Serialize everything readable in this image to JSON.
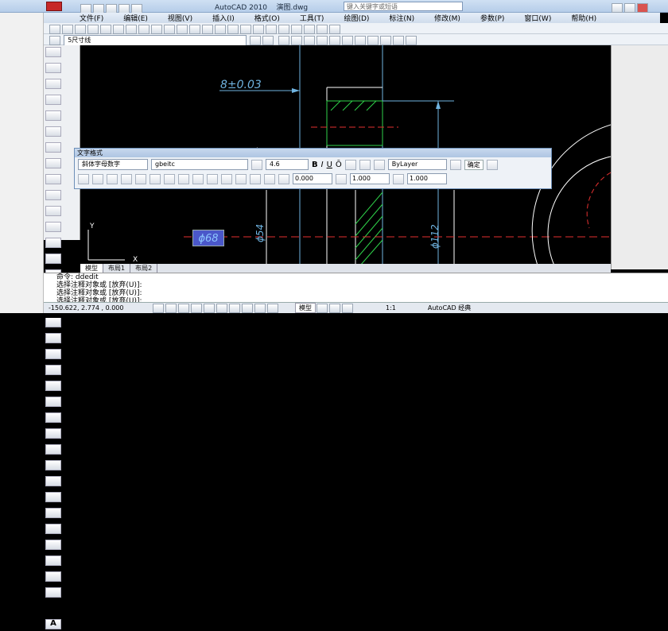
{
  "window": {
    "title": "AutoCAD 2010",
    "file": "演图.dwg",
    "search_placeholder": "键入关键字或短语"
  },
  "menu": [
    "文件(F)",
    "编辑(E)",
    "视图(V)",
    "插入(I)",
    "格式(O)",
    "工具(T)",
    "绘图(D)",
    "标注(N)",
    "修改(M)",
    "参数(P)",
    "窗口(W)",
    "帮助(H)"
  ],
  "layer_toolbar": {
    "layer_name": "5尺寸线"
  },
  "drawing": {
    "dimension_tolerance": "8±0.03",
    "dim_left": "ϕ54",
    "dim_right": "ϕ112",
    "edit_badge": "ϕ68",
    "ucs_x": "X",
    "ucs_y": "Y"
  },
  "text_formatting": {
    "title": "文字格式",
    "style": "斜体字母数字",
    "font": "gbeitc",
    "height": "4.6",
    "color": "ByLayer",
    "ok": "确定",
    "angle": "0.000",
    "spacing": "1.000",
    "width": "1.000",
    "bold": "B",
    "italic": "I",
    "underline": "U",
    "overline": "Ō"
  },
  "tabs": [
    "模型",
    "布局1",
    "布局2"
  ],
  "command_lines": [
    "命令:  ddedit",
    "选择注释对象或 [放弃(U)]:",
    "选择注释对象或 [放弃(U)]:",
    "选择注释对象或 [放弃(U)]:"
  ],
  "status": {
    "coords": "-150.622, 2.774 , 0.000",
    "model_label": "模型",
    "scale": "1:1",
    "workspace": "AutoCAD 经典"
  }
}
